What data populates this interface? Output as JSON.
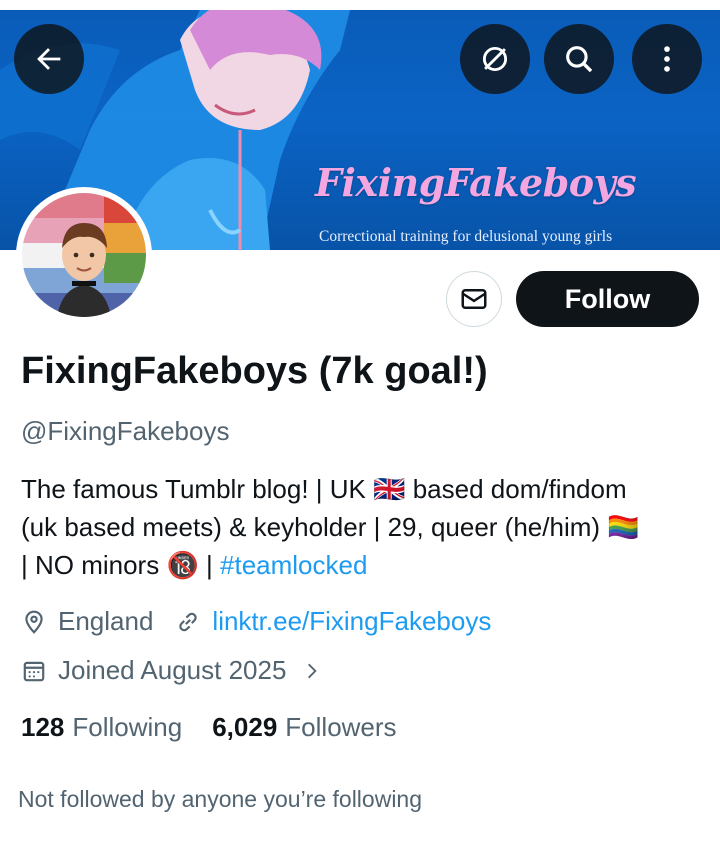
{
  "banner": {
    "title": "FixingFakeboys",
    "subtitle": "Correctional training for delusional young girls"
  },
  "nav": {
    "back_icon": "arrow-left-icon",
    "grok_icon": "grok-icon",
    "search_icon": "search-icon",
    "more_icon": "more-vertical-icon"
  },
  "profile": {
    "display_name": "FixingFakeboys (7k goal!)",
    "handle": "@FixingFakeboys",
    "bio_line1": "The famous Tumblr blog! | UK 🇬🇧 based dom/findom",
    "bio_line2": "(uk based meets) & keyholder | 29, queer (he/him) 🏳️‍🌈",
    "bio_line3_prefix": "| NO minors 🔞 | ",
    "bio_hashtag": "#teamlocked",
    "location": "England",
    "website": "linktr.ee/FixingFakeboys",
    "joined": "Joined August 2025"
  },
  "actions": {
    "follow_label": "Follow",
    "message_icon": "envelope-icon"
  },
  "stats": {
    "following_count": "128",
    "following_label": "Following",
    "followers_count": "6,029",
    "followers_label": "Followers"
  },
  "footer": {
    "not_followed_text": "Not followed by anyone you’re following"
  },
  "colors": {
    "accent": "#1d9bf0",
    "text_primary": "#0f1419",
    "text_secondary": "#536471",
    "banner_blue": "#0b63c4",
    "banner_title_pink": "#f4a6e0"
  }
}
